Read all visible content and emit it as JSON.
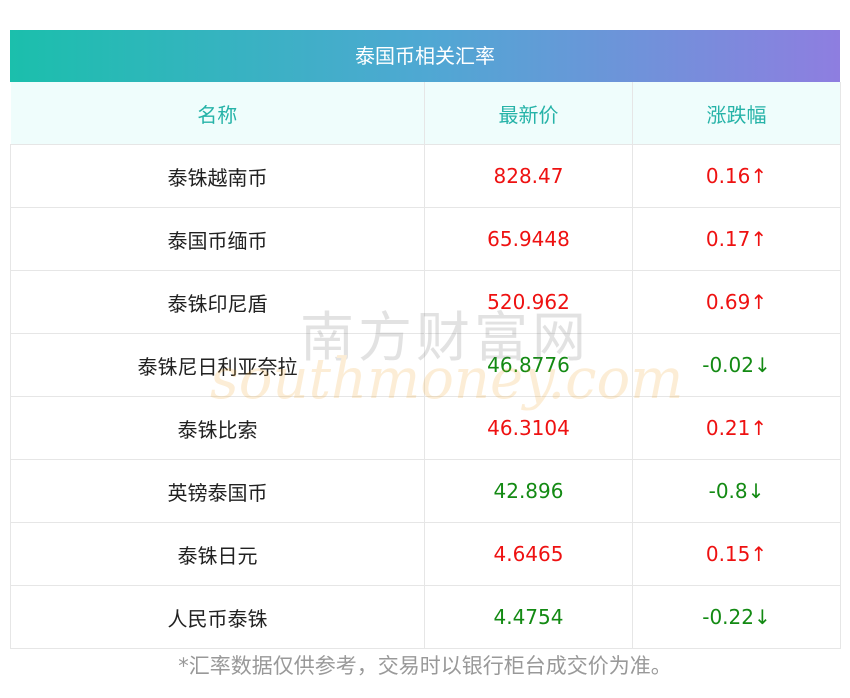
{
  "title": "泰国币相关汇率",
  "columns": {
    "name": "名称",
    "price": "最新价",
    "change": "涨跌幅"
  },
  "rows": [
    {
      "name": "泰铢越南币",
      "price": "828.47",
      "change": "0.16↑",
      "dir": "up"
    },
    {
      "name": "泰国币缅币",
      "price": "65.9448",
      "change": "0.17↑",
      "dir": "up"
    },
    {
      "name": "泰铢印尼盾",
      "price": "520.962",
      "change": "0.69↑",
      "dir": "up"
    },
    {
      "name": "泰铢尼日利亚奈拉",
      "price": "46.8776",
      "change": "-0.02↓",
      "dir": "down"
    },
    {
      "name": "泰铢比索",
      "price": "46.3104",
      "change": "0.21↑",
      "dir": "up"
    },
    {
      "name": "英镑泰国币",
      "price": "42.896",
      "change": "-0.8↓",
      "dir": "down"
    },
    {
      "name": "泰铢日元",
      "price": "4.6465",
      "change": "0.15↑",
      "dir": "up"
    },
    {
      "name": "人民币泰铢",
      "price": "4.4754",
      "change": "-0.22↓",
      "dir": "down"
    }
  ],
  "colors": {
    "up": "#ee1111",
    "down": "#138a13",
    "header_text": "#26b3a8"
  },
  "watermark": {
    "cn": "南方财富网",
    "en": "southmoney.com"
  },
  "note": "*汇率数据仅供参考，交易时以银行柜台成交价为准。"
}
